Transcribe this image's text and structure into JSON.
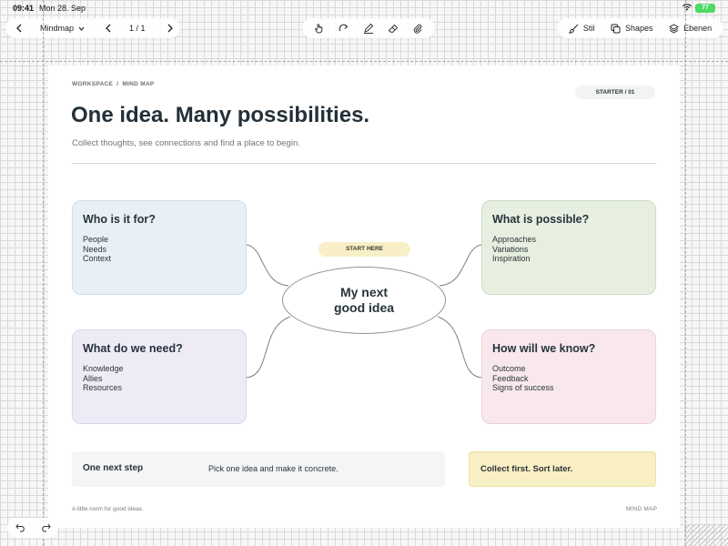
{
  "status": {
    "time": "09:41",
    "date": "Mon 28. Sep",
    "battery": "77"
  },
  "toolbar": {
    "back_icon": "chevron-left-icon",
    "document_name": "Mindmap",
    "page_indicator": "1 / 1",
    "tools": [
      "hand-pointer-icon",
      "redo-arrow-icon",
      "pen-icon",
      "eraser-icon",
      "paperclip-icon"
    ],
    "style_label": "Stil",
    "shapes_label": "Shapes",
    "layers_label": "Ebenen"
  },
  "page": {
    "breadcrumb": [
      "WORKSPACE",
      "/",
      "MIND MAP"
    ],
    "tag": "STARTER / 01",
    "title": "One idea. Many possibilities.",
    "subtitle": "Collect thoughts, see connections and find a place to begin.",
    "center": {
      "tag": "START HERE",
      "line1": "My next",
      "line2": "good idea"
    },
    "cards": {
      "who": {
        "title": "Who is it for?",
        "items": [
          "People",
          "Needs",
          "Context"
        ]
      },
      "what": {
        "title": "What is possible?",
        "items": [
          "Approaches",
          "Variations",
          "Inspiration"
        ]
      },
      "need": {
        "title": "What do we need?",
        "items": [
          "Knowledge",
          "Allies",
          "Resources"
        ]
      },
      "know": {
        "title": "How will we know?",
        "items": [
          "Outcome",
          "Feedback",
          "Signs of success"
        ]
      }
    },
    "next_step": {
      "label": "One next step",
      "text": "Pick one idea and make it concrete."
    },
    "note": "Collect first. Sort later.",
    "footer_left": "A little room for good ideas.",
    "footer_right": "MIND MAP"
  },
  "colors": {
    "card_blue": "#e8f0f5",
    "card_green": "#e6efe0",
    "card_purple": "#eeebf6",
    "card_pink": "#f8e8ec",
    "highlight_yellow": "#f9efc4"
  }
}
